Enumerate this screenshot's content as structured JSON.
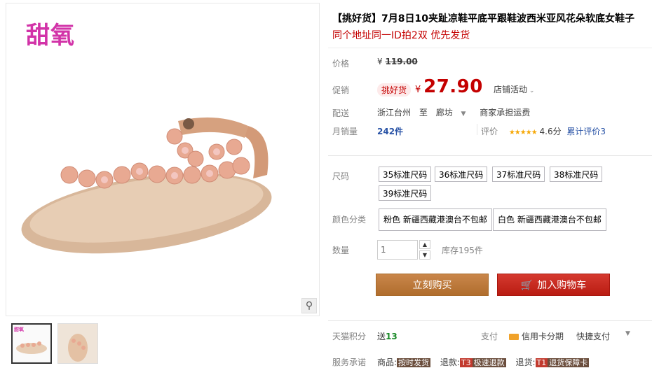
{
  "gallery": {
    "brand_logo": "甜氧",
    "zoom_icon": "magnifier-icon",
    "thumb_tag": "甜氧"
  },
  "product": {
    "title": "【挑好货】7月8日10夹趾凉鞋平底平跟鞋波西米亚风花朵软底女鞋子",
    "subtitle": "同个地址同一ID拍2双 优先发货"
  },
  "price": {
    "label": "价格",
    "currency": "¥",
    "original": "119.00"
  },
  "promo": {
    "label": "促销",
    "tag": "挑好货",
    "currency": "¥",
    "price": "27.90",
    "activity": "店铺活动"
  },
  "shipping": {
    "label": "配送",
    "from": "浙江台州",
    "to_word": "至",
    "to": "廊坊",
    "fee": "商家承担运费"
  },
  "sales": {
    "label": "月销量",
    "count": "242件",
    "rating_label": "评价",
    "stars": "★★★★★",
    "score": "4.6分",
    "total": "累计评价3"
  },
  "options": {
    "size_label": "尺码",
    "sizes": [
      "35标准尺码",
      "36标准尺码",
      "37标准尺码",
      "38标准尺码",
      "39标准尺码"
    ],
    "color_label": "颜色分类",
    "colors": [
      "粉色 新疆西藏港澳台不包邮",
      "白色 新疆西藏港澳台不包邮"
    ],
    "qty_label": "数量",
    "qty_value": "1",
    "stock": "库存195件"
  },
  "actions": {
    "buy_now": "立刻购买",
    "add_cart": "加入购物车"
  },
  "footer": {
    "points_label": "天猫积分",
    "points_prefix": "送",
    "points_value": "13",
    "pay_label": "支付",
    "card_pay": "信用卡分期",
    "quick_pay": "快捷支付",
    "service_label": "服务承诺",
    "goods_label": "商品:",
    "goods_badge": "按时发货",
    "refund_label": "退款:",
    "refund_code": "T3",
    "refund_badge": "极速退款",
    "return_label": "退货:",
    "return_code": "T1",
    "return_badge": "退货保障卡"
  },
  "colors": {
    "accent_red": "#c40000",
    "buy_brown": "#bb7a35",
    "cart_red": "#c8281e",
    "brand_pink": "#d233a8"
  }
}
